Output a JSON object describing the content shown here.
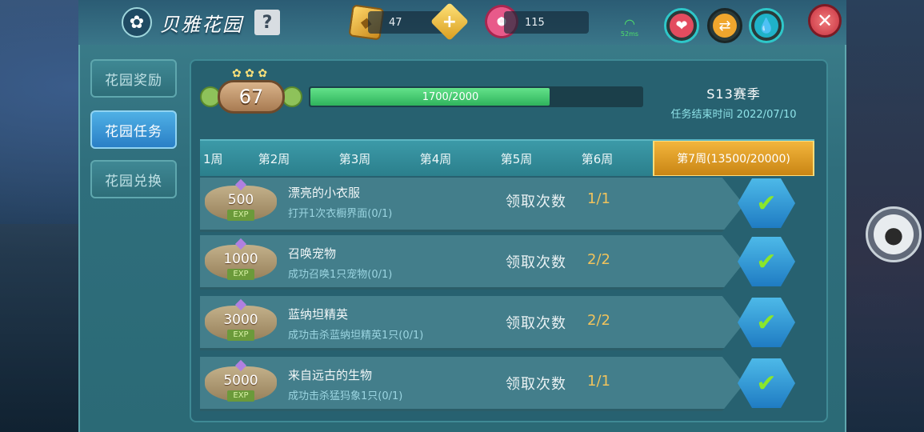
{
  "window": {
    "title": "贝雅花园",
    "help_label": "?",
    "close_label": "✕"
  },
  "currencies": {
    "gem": {
      "value": "47",
      "icon": "gem-icon",
      "add_label": "+"
    },
    "flower": {
      "value": "115",
      "icon": "flower-icon"
    }
  },
  "status": {
    "ping": "52ms",
    "signal_icon": "wifi-icon"
  },
  "round_buttons": {
    "heart": {
      "icon": "heart-icon",
      "glyph": "❤"
    },
    "swap": {
      "icon": "swap-icon",
      "glyph": "⇄"
    },
    "drop": {
      "icon": "water-drop-icon",
      "glyph": "💧"
    }
  },
  "sidebar": {
    "items": [
      {
        "label": "花园奖励",
        "active": false
      },
      {
        "label": "花园任务",
        "active": true
      },
      {
        "label": "花园兑换",
        "active": false
      }
    ]
  },
  "level": {
    "value": "67"
  },
  "progress": {
    "text": "1700/2000",
    "current": 1700,
    "max": 2000
  },
  "season": {
    "name": "S13赛季",
    "end_text": "任务结束时间 2022/07/10"
  },
  "weeks": [
    {
      "label": "1周",
      "active": false
    },
    {
      "label": "第2周",
      "active": false
    },
    {
      "label": "第3周",
      "active": false
    },
    {
      "label": "第4周",
      "active": false
    },
    {
      "label": "第5周",
      "active": false
    },
    {
      "label": "第6周",
      "active": false
    },
    {
      "label": "第7周(13500/20000)",
      "active": true
    }
  ],
  "tasks": [
    {
      "exp": "500",
      "exp_tag": "EXP",
      "title": "漂亮的小衣服",
      "desc": "打开1次衣橱界面(0/1)",
      "count_label": "领取次数",
      "count": "1/1",
      "done": true
    },
    {
      "exp": "1000",
      "exp_tag": "EXP",
      "title": "召唤宠物",
      "desc": "成功召唤1只宠物(0/1)",
      "count_label": "领取次数",
      "count": "2/2",
      "done": true
    },
    {
      "exp": "3000",
      "exp_tag": "EXP",
      "title": "蓝纳坦精英",
      "desc": "成功击杀蓝纳坦精英1只(0/1)",
      "count_label": "领取次数",
      "count": "2/2",
      "done": true
    },
    {
      "exp": "5000",
      "exp_tag": "EXP",
      "title": "来自远古的生物",
      "desc": "成功击杀猛犸象1只(0/1)",
      "count_label": "领取次数",
      "count": "1/1",
      "done": true
    }
  ],
  "colors": {
    "panel": "#2f6e7c",
    "active_tab": "#2a7fc6",
    "active_week": "#f2b53c",
    "progress_fill": "#2fb35c",
    "count_text": "#f0c35c",
    "check": "#8ae62c"
  }
}
